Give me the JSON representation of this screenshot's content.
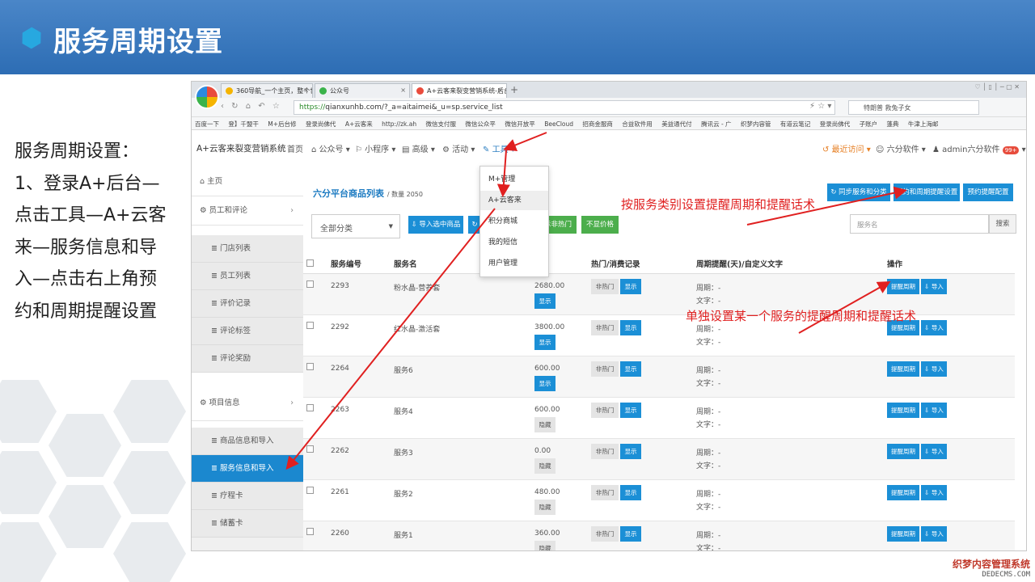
{
  "slide": {
    "title": "服务周期设置",
    "instructions": [
      "服务周期设置：",
      "1、登录A+后台—",
      "点击工具—A+云客",
      "来—服务信息和导",
      "入—点击右上角预",
      "约和周期提醒设置"
    ]
  },
  "browser": {
    "tabs": [
      "360导航_一个主页，整个世界",
      "公众号",
      "A+云客来裂变营销系统-后台"
    ],
    "url_scheme": "https://",
    "url_rest": "qianxunhb.com/?_a=aitaimei&_u=sp.service_list",
    "search_text": "特朗普 救兔子女",
    "bookmarks": [
      "百度一下",
      "登】千盟干",
      "M+后台修",
      "登录尚佛代",
      "A+云客来",
      "http://zk.ah",
      "微信支付服",
      "微信公众平",
      "微信开放平",
      "BeeCloud",
      "招商金服商",
      "合益软件用",
      "美益通代付",
      "腾讯云 - 广",
      "织梦内容管",
      "有道云笔记",
      "登录尚佛代",
      "子账户",
      "蓬典",
      "牛津上海邮"
    ]
  },
  "app": {
    "brand": "A+云客来裂变营销系统",
    "nav": [
      "首页",
      "公众号",
      "小程序",
      "高级",
      "活动",
      "工具"
    ],
    "right_nav": [
      "最近访问",
      "六分软件",
      "admin六分软件"
    ],
    "badge": "99+"
  },
  "sidebar": {
    "home": "主页",
    "group1": "员工和评论",
    "group1_items": [
      "门店列表",
      "员工列表",
      "评价记录",
      "评论标签",
      "评论奖励"
    ],
    "group2": "项目信息",
    "group2_items": [
      "商品信息和导入",
      "服务信息和导入",
      "疗程卡",
      "储蓄卡"
    ]
  },
  "main": {
    "list_title": "六分平台商品列表",
    "count": "/ 数量 2050",
    "category": "全部分类",
    "buttons": {
      "import": "导入选中商品",
      "hot_fragment": "示非热门",
      "no_price": "不显价格",
      "sync": "同步服务和分类",
      "reserve": "预约和周期提醒设置",
      "reserve_cfg": "预约提醒配置"
    },
    "search_placeholder": "服务名",
    "search_button": "搜索",
    "columns": [
      "服务编号",
      "服务名",
      "热门/消费记录",
      "周期提醒(天)/自定义文字",
      "操作"
    ],
    "row_labels": {
      "period": "周期：-",
      "text": "文字：-",
      "not_hot": "非热门",
      "show": "显示",
      "hide": "隐藏",
      "remind": "提醒周期",
      "import": "导入"
    },
    "rows": [
      {
        "id": "2293",
        "name": "粉水晶-营养套",
        "price": "2680.00",
        "vis": "显示"
      },
      {
        "id": "2292",
        "name": "红水晶-激活套",
        "price": "3800.00",
        "vis": "显示"
      },
      {
        "id": "2264",
        "name": "服务6",
        "price": "600.00",
        "vis": "显示"
      },
      {
        "id": "2263",
        "name": "服务4",
        "price": "600.00",
        "vis": "隐藏"
      },
      {
        "id": "2262",
        "name": "服务3",
        "price": "0.00",
        "vis": "隐藏"
      },
      {
        "id": "2261",
        "name": "服务2",
        "price": "480.00",
        "vis": "隐藏"
      },
      {
        "id": "2260",
        "name": "服务1",
        "price": "360.00",
        "vis": "隐藏"
      }
    ]
  },
  "dropdown": [
    "M+管理",
    "A+云客来",
    "积分商城",
    "我的短信",
    "用户管理"
  ],
  "annotations": [
    "按服务类别设置提醒周期和提醒话术",
    "单独设置某一个服务的提醒周期和提醒话术"
  ],
  "watermark": {
    "line1": "织梦内容管理系统",
    "line2": "DEDECMS.COM"
  },
  "colors": {
    "header": "#2d6db4",
    "primary": "#1b8fd6",
    "green": "#4cae4c",
    "annotation": "#e02020"
  }
}
